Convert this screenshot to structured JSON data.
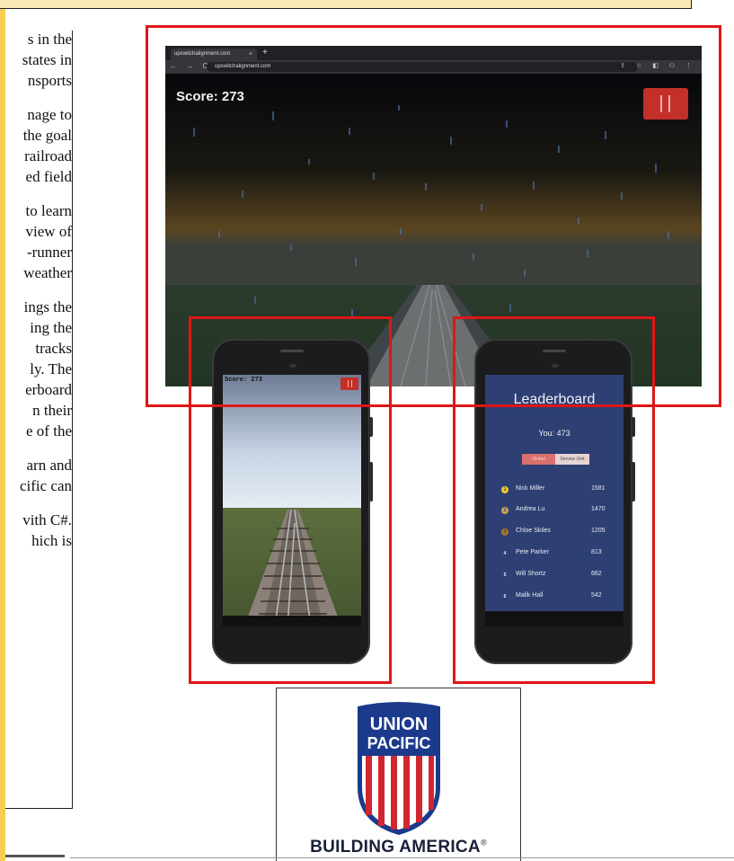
{
  "article_text": {
    "lines": [
      "s in the",
      "states in",
      "nsports",
      "nage to",
      "the goal",
      "railroad",
      "ed field",
      "to learn",
      "view of",
      "-runner",
      "weather",
      "ings the",
      "ing the",
      "tracks",
      "ly. The",
      "erboard",
      "n their",
      "e of the",
      "arn and",
      "cific can",
      "vith C#.",
      "hich is"
    ]
  },
  "browser": {
    "tab_title": "upswitchalignment.com",
    "tab_close": "×",
    "new_tab": "+",
    "nav_icons": "← → C",
    "url": "upswitchalignment.com",
    "toolbar_icons": "⇪ ☆ ◧ ⚇ ⋮",
    "score_label": "Score: 273"
  },
  "phone_game": {
    "score_label": "Score: 273"
  },
  "phone_leaderboard": {
    "title": "Leaderboard",
    "you_label": "You: 473",
    "tabs": [
      "Global",
      "Service Unit"
    ],
    "rows": [
      {
        "rank": "1",
        "name": "Nick Miller",
        "score": "1581",
        "medal": "#f0c82a"
      },
      {
        "rank": "2",
        "name": "Andrea Lu",
        "score": "1470",
        "medal": "#c9a257"
      },
      {
        "rank": "3",
        "name": "Chloe Skiles",
        "score": "1205",
        "medal": "#a9772c"
      },
      {
        "rank": "4",
        "name": "Pete Parker",
        "score": "813",
        "medal": ""
      },
      {
        "rank": "5",
        "name": "Will Shortz",
        "score": "662",
        "medal": ""
      },
      {
        "rank": "6",
        "name": "Malik Hall",
        "score": "542",
        "medal": ""
      }
    ]
  },
  "logo": {
    "top_word": "UNION",
    "bottom_word": "PACIFIC",
    "tagline": "BUILDING AMERICA",
    "tagline_mark": "®"
  },
  "colors": {
    "highlight": "#e01616",
    "pause_button": "#c3302a",
    "leaderboard_bg": "#2e3f73",
    "logo_blue": "#1c3a8c",
    "logo_red": "#d12630"
  }
}
